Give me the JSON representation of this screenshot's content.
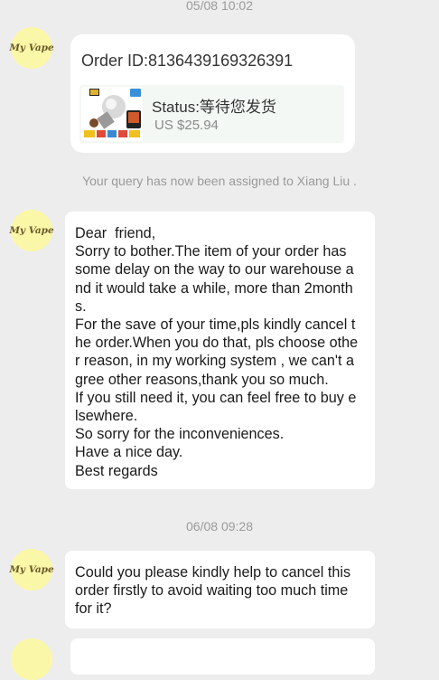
{
  "timestamps": [
    "05/08 10:02",
    "06/08 09:28"
  ],
  "avatar_label": "My Vape",
  "order": {
    "id_text": "Order ID:8136439169326391",
    "status_text": "Status:等待您发货",
    "price": "US $25.94"
  },
  "notice": "Your query has now been assigned to Xiang Liu .",
  "message1_lines": [
    "Dear  friend,",
    "Sorry to bother.The item of your order has",
    "some delay on the way to our warehouse a",
    "nd it would take a while, more than 2month",
    "s.",
    "For the save of your time,pls kindly cancel t",
    "he order.When you do that, pls choose othe",
    "r reason, in my working system , we can't a",
    "gree other reasons,thank you so much.",
    "If you still need it, you can feel free to buy e",
    "lsewhere.",
    "So sorry for the inconveniences.",
    "Have a nice day.",
    "Best regards"
  ],
  "message2_lines": [
    "Could you please kindly help to cancel this",
    "order firstly to avoid waiting too much time",
    "for it?"
  ]
}
